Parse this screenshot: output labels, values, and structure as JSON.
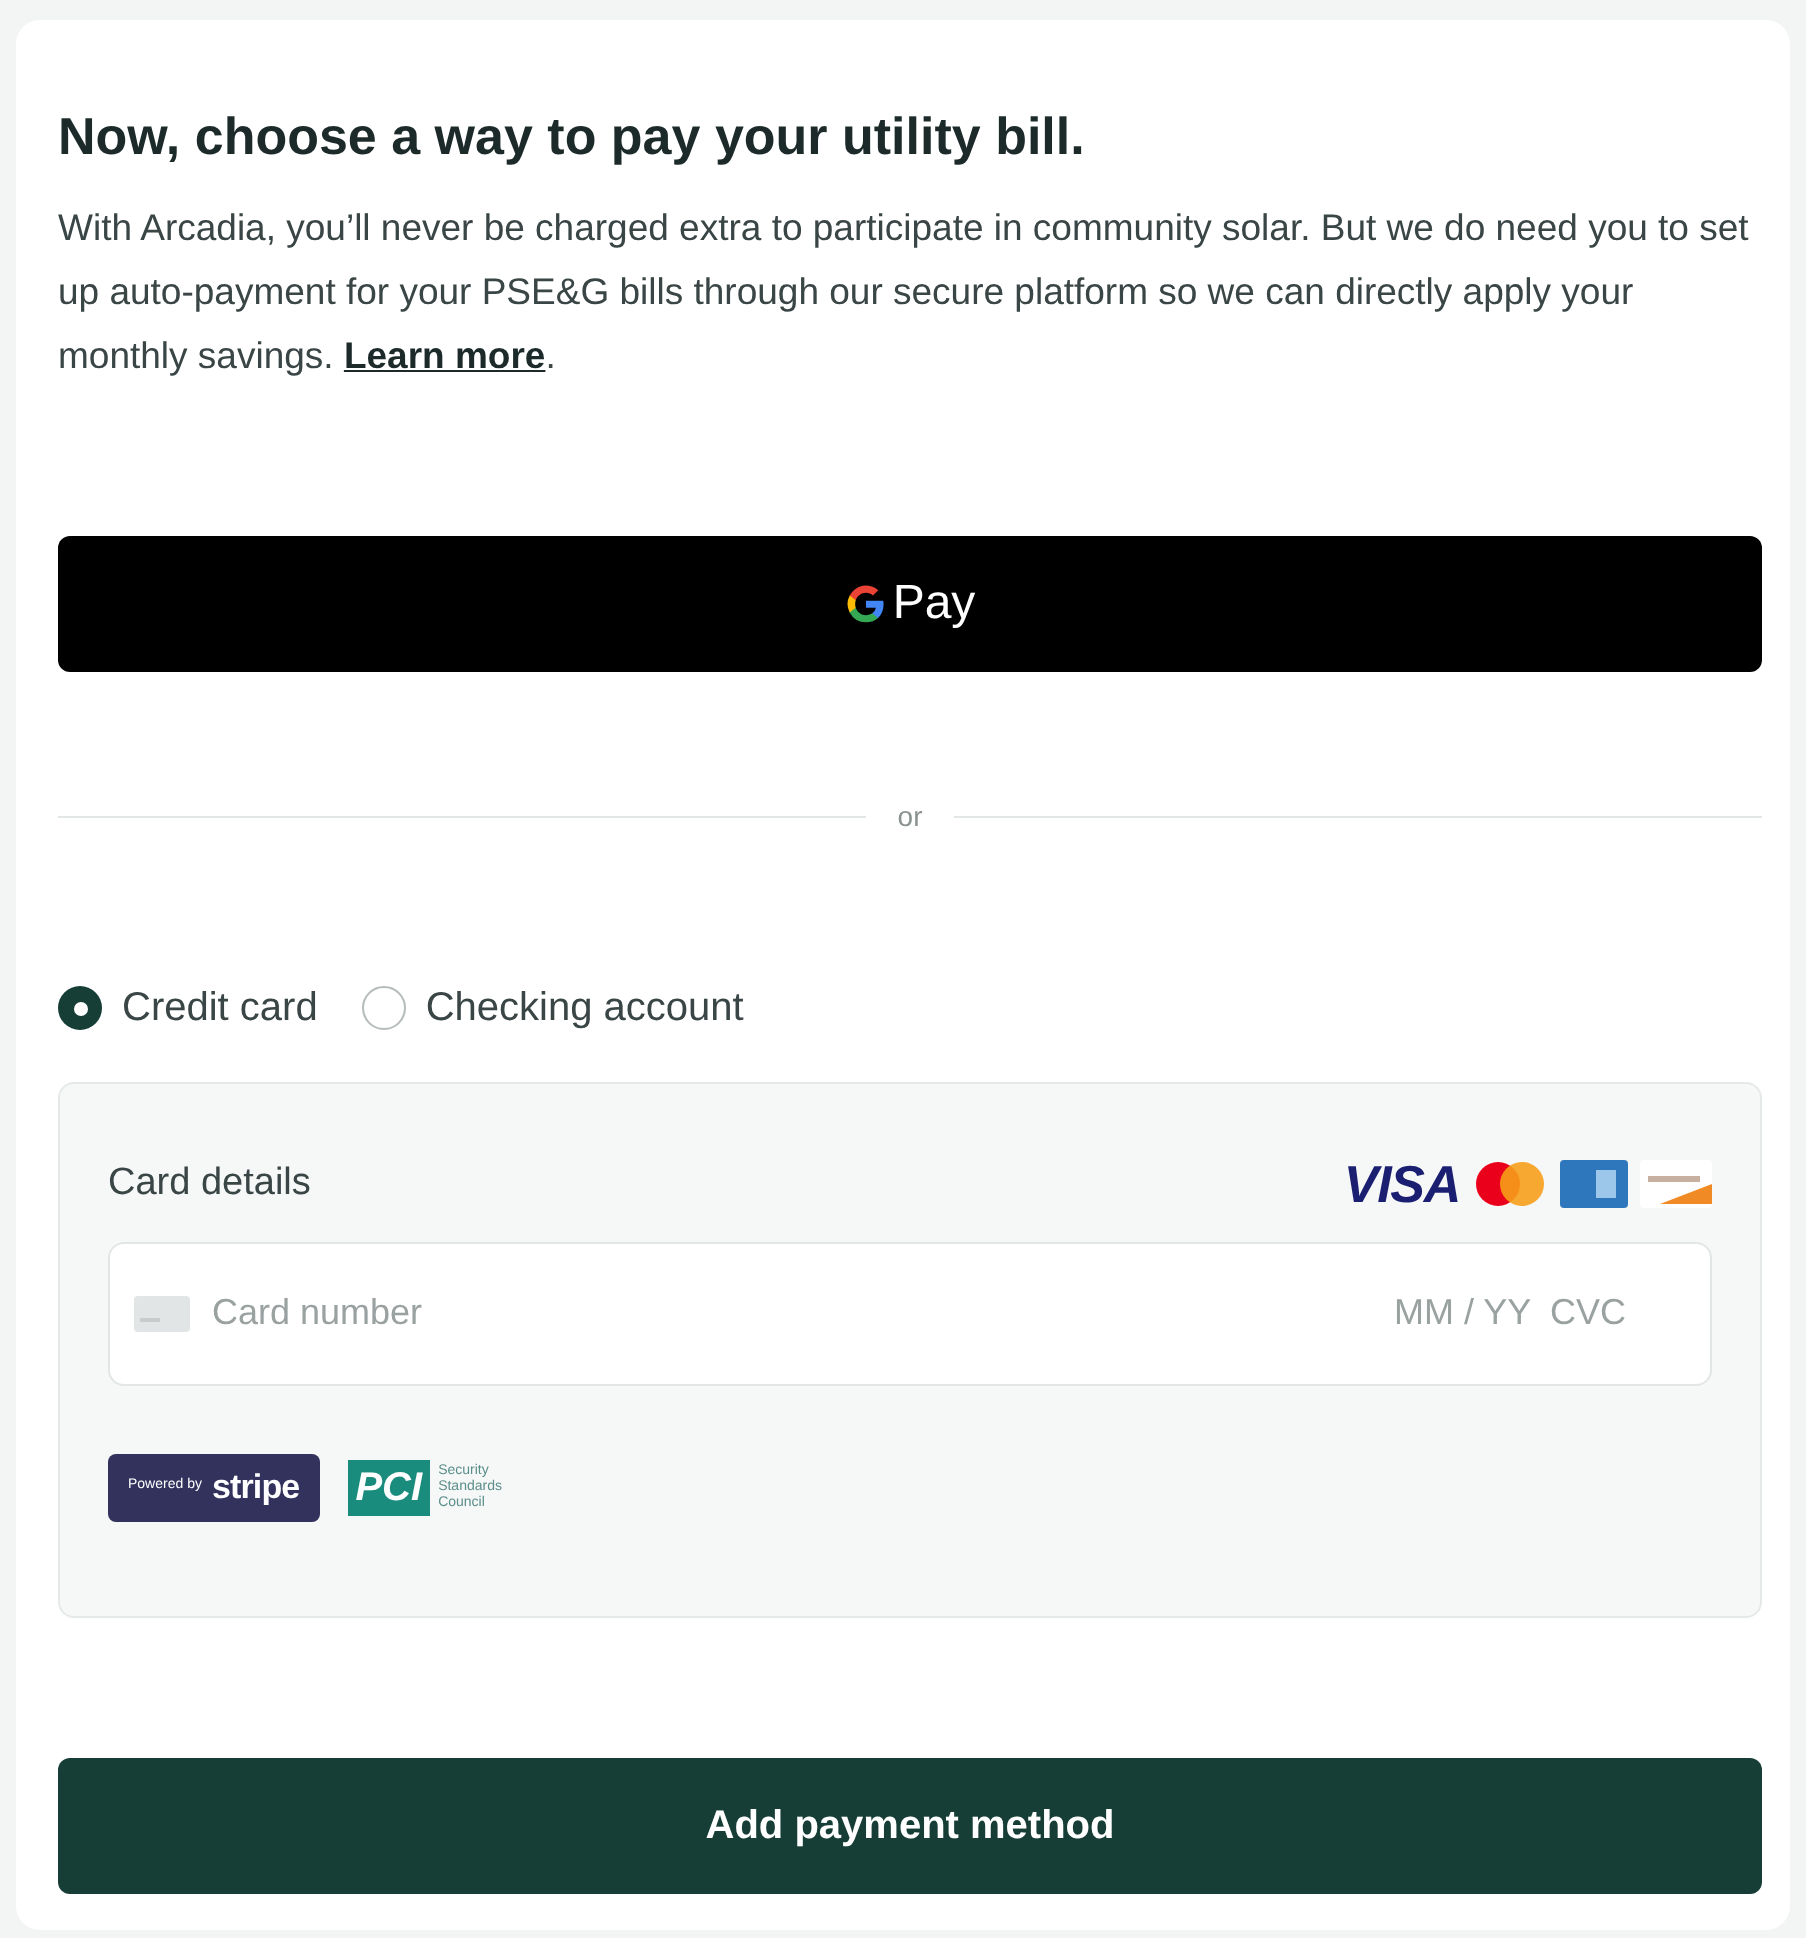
{
  "heading": "Now, choose a way to pay your utility bill.",
  "intro": {
    "text": "With Arcadia, you’ll never be charged extra to participate in community solar. But we do need you to set up auto-payment for your PSE&G bills through our secure platform so we can directly apply your monthly savings.",
    "link": "Learn more",
    "after": "."
  },
  "gpay_button": {
    "label": "Pay"
  },
  "divider": "or",
  "payment_types": [
    {
      "label": "Credit card",
      "selected": true
    },
    {
      "label": "Checking account",
      "selected": false
    }
  ],
  "card_panel": {
    "title": "Card details",
    "brands": [
      "VISA"
    ],
    "card_number": {
      "placeholder": "Card number"
    },
    "expiry": {
      "placeholder": "MM / YY"
    },
    "cvc": {
      "placeholder": "CVC"
    },
    "stripe_badge": {
      "prefix": "Powered by",
      "name": "stripe"
    },
    "pci_badge": {
      "name": "PCI",
      "caption": "Security Standards Council"
    }
  },
  "submit_button": "Add payment method"
}
